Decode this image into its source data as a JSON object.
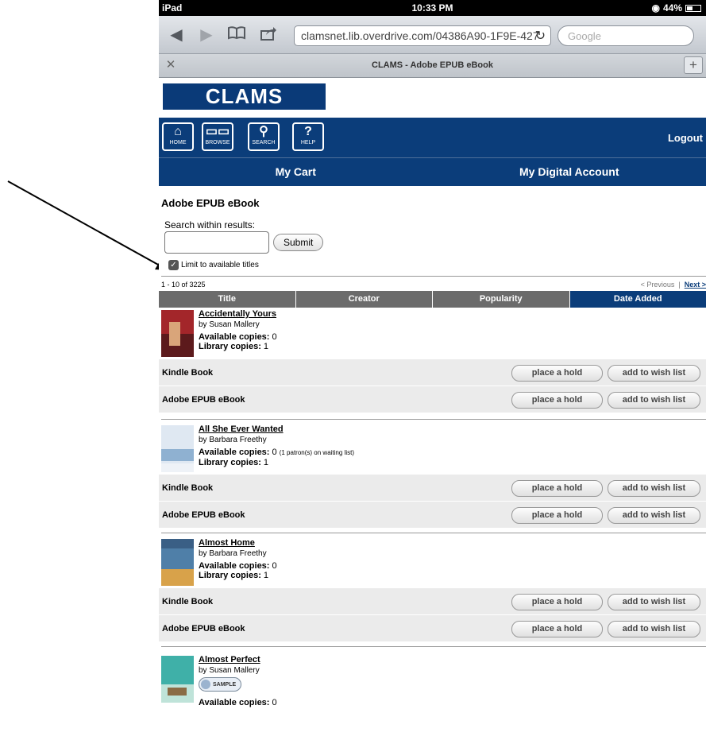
{
  "status_bar": {
    "carrier": "iPad",
    "time": "10:33 PM",
    "battery": "44%"
  },
  "browser": {
    "url": "clamsnet.lib.overdrive.com/04386A90-1F9E-427",
    "search_placeholder": "Google",
    "tab_title": "CLAMS - Adobe EPUB eBook"
  },
  "site": {
    "logo": "CLAMS",
    "nav": [
      {
        "label": "HOME",
        "icon": "home-icon"
      },
      {
        "label": "BROWSE",
        "icon": "book-icon"
      },
      {
        "label": "SEARCH",
        "icon": "magnifier-icon"
      },
      {
        "label": "HELP",
        "icon": "question-icon"
      }
    ],
    "logout": "Logout",
    "my_cart": "My Cart",
    "my_account": "My Digital Account"
  },
  "page": {
    "heading": "Adobe EPUB eBook",
    "search_label": "Search within results:",
    "submit": "Submit",
    "limit_label": "Limit to available titles",
    "result_count": "1 - 10 of 3225",
    "previous": "< Previous",
    "next": "Next >",
    "sort_columns": [
      "Title",
      "Creator",
      "Popularity",
      "Date Added"
    ],
    "active_sort": "Date Added",
    "place_hold": "place a hold",
    "wish_list": "add to wish list",
    "sample_label": "SAMPLE"
  },
  "books": [
    {
      "title": "Accidentally Yours",
      "author": "by Susan Mallery",
      "available_label": "Available copies:",
      "available": "0",
      "waiting_note": "",
      "library_label": "Library copies:",
      "library": "1",
      "formats": [
        "Kindle Book",
        "Adobe EPUB eBook"
      ]
    },
    {
      "title": "All She Ever Wanted",
      "author": "by Barbara Freethy",
      "available_label": "Available copies:",
      "available": "0",
      "waiting_note": "(1 patron(s) on waiting list)",
      "library_label": "Library copies:",
      "library": "1",
      "formats": [
        "Kindle Book",
        "Adobe EPUB eBook"
      ]
    },
    {
      "title": "Almost Home",
      "author": "by Barbara Freethy",
      "available_label": "Available copies:",
      "available": "0",
      "waiting_note": "",
      "library_label": "Library copies:",
      "library": "1",
      "formats": [
        "Kindle Book",
        "Adobe EPUB eBook"
      ]
    },
    {
      "title": "Almost Perfect",
      "author": "by Susan Mallery",
      "available_label": "Available copies:",
      "available": "0"
    }
  ],
  "colors": {
    "brand_blue": "#0b3d7a",
    "sort_gray": "#6b6b6b"
  }
}
